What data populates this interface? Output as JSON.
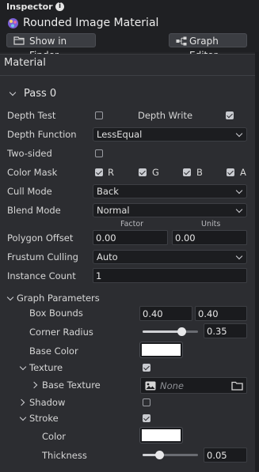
{
  "inspector": {
    "title": "Inspector",
    "asset_name": "Rounded Image Material",
    "show_in_finder": "Show in Finder",
    "graph_editor": "Graph Editor"
  },
  "material": {
    "section": "Material",
    "pass": "Pass 0",
    "depth_test_label": "Depth Test",
    "depth_test": false,
    "depth_write_label": "Depth Write",
    "depth_write": true,
    "depth_function_label": "Depth Function",
    "depth_function": "LessEqual",
    "two_sided_label": "Two-sided",
    "two_sided": false,
    "color_mask_label": "Color Mask",
    "color_mask": [
      {
        "label": "R",
        "checked": true
      },
      {
        "label": "G",
        "checked": true
      },
      {
        "label": "B",
        "checked": true
      },
      {
        "label": "A",
        "checked": true
      }
    ],
    "cull_mode_label": "Cull Mode",
    "cull_mode": "Back",
    "blend_mode_label": "Blend Mode",
    "blend_mode": "Normal",
    "polygon_offset_label": "Polygon Offset",
    "factor_label": "Factor",
    "units_label": "Units",
    "factor_value": "0.00",
    "units_value": "0.00",
    "frustum_culling_label": "Frustum Culling",
    "frustum_culling": "Auto",
    "instance_count_label": "Instance Count",
    "instance_count": "1"
  },
  "graph_params": {
    "section": "Graph Parameters",
    "box_bounds_label": "Box Bounds",
    "box_bounds_x": "0.40",
    "box_bounds_y": "0.40",
    "corner_radius_label": "Corner Radius",
    "corner_radius": "0.35",
    "corner_radius_fraction": 0.7,
    "base_color_label": "Base Color",
    "base_color": "#ffffff",
    "texture_label": "Texture",
    "texture_enabled": true,
    "base_texture_label": "Base Texture",
    "base_texture_value": "None",
    "shadow_label": "Shadow",
    "shadow_enabled": false,
    "stroke_label": "Stroke",
    "stroke_enabled": true,
    "color_label": "Color",
    "stroke_color": "#ffffff",
    "thickness_label": "Thickness",
    "thickness": "0.05",
    "thickness_fraction": 0.3
  },
  "icons": [
    "info-icon",
    "material-asset-icon",
    "finder-icon",
    "graph-icon",
    "image-icon",
    "folder-icon",
    "chevron-down-icon",
    "chevron-right-icon"
  ]
}
